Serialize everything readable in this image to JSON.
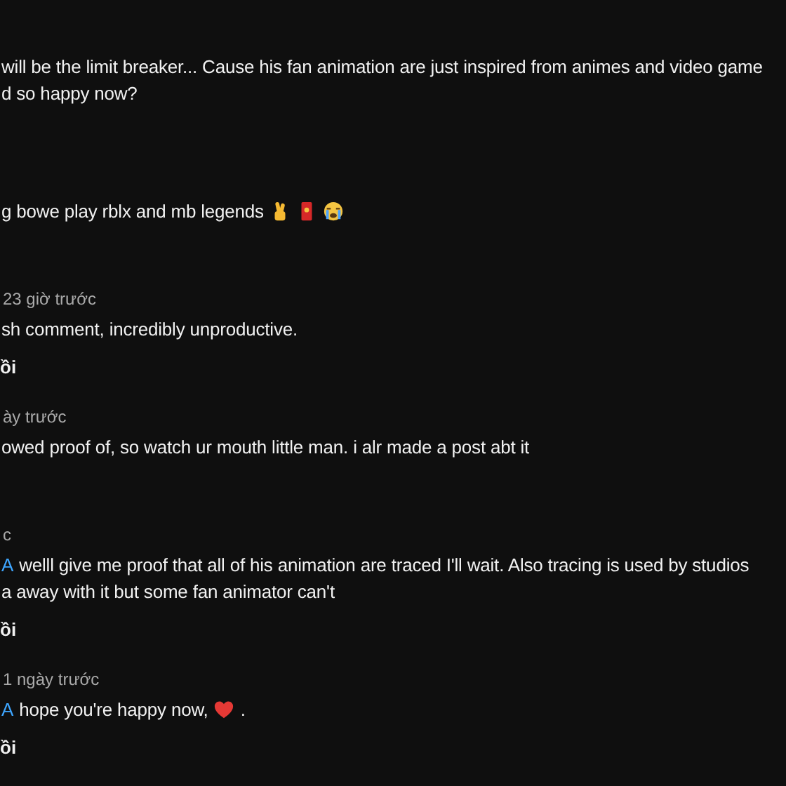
{
  "comments": [
    {
      "lines": [
        [
          {
            "kind": "text",
            "text": "will be the limit breaker... Cause his fan animation are just inspired from animes and video game"
          }
        ],
        [
          {
            "kind": "text",
            "text": "d so happy now?"
          }
        ]
      ]
    },
    {
      "lines": [
        [
          {
            "kind": "text",
            "text": "g bowe play rblx and mb legends"
          },
          {
            "kind": "crossed-fingers"
          },
          {
            "kind": "red-envelope"
          },
          {
            "kind": "crying-face"
          }
        ]
      ]
    },
    {
      "meta": "23 giờ trước",
      "lines": [
        [
          {
            "kind": "text",
            "text": "sh comment, incredibly unproductive."
          }
        ]
      ],
      "reply": "ồi"
    },
    {
      "meta": "ày trước",
      "lines": [
        [
          {
            "kind": "text",
            "text": "owed proof of, so watch ur mouth little man. i alr made a post abt it"
          }
        ]
      ]
    },
    {
      "meta": "c",
      "lines": [
        [
          {
            "kind": "mention",
            "text": "A"
          },
          {
            "kind": "text",
            "text": "welll give me proof that all of his animation are traced I'll wait. Also tracing is used by studios"
          }
        ],
        [
          {
            "kind": "text",
            "text": "a away with it but some fan animator can't"
          }
        ]
      ],
      "reply": "ồi"
    },
    {
      "meta": "1 ngày trước",
      "lines": [
        [
          {
            "kind": "mention",
            "text": "A"
          },
          {
            "kind": "text",
            "text": "hope you're happy now,"
          },
          {
            "kind": "heart"
          },
          {
            "kind": "text",
            "text": "."
          }
        ]
      ],
      "reply": "ồi"
    }
  ]
}
